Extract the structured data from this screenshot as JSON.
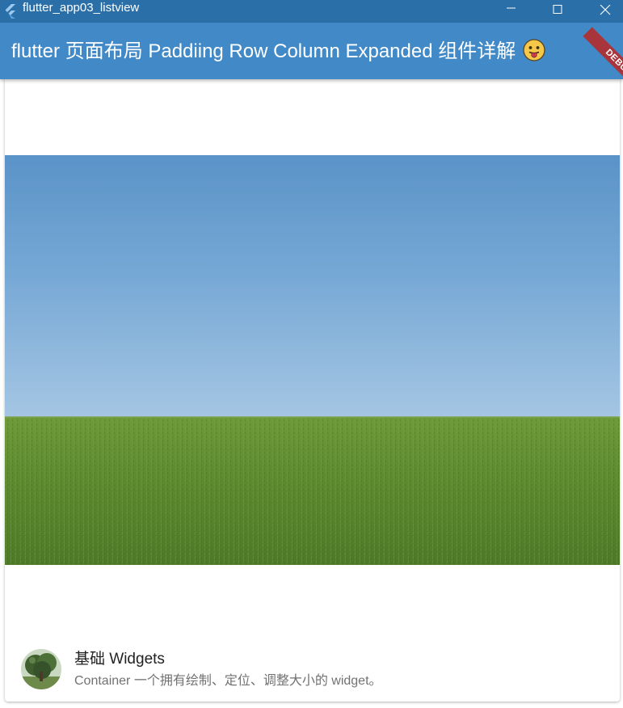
{
  "window": {
    "title": "flutter_app03_listview",
    "app_icon": "flutter-icon",
    "controls": [
      "minimize-icon",
      "maximize-icon",
      "close-icon"
    ]
  },
  "appbar": {
    "title": "flutter 页面布局 Paddiing Row Column Expanded 组件详解",
    "title_emoji": "face-with-tongue-emoji",
    "background": "#4189c7",
    "debug_banner": "DEBUG"
  },
  "card": {
    "image": "grass-field-blue-sky-photo",
    "tile": {
      "avatar": "tree-photo-avatar",
      "title": "基础 Widgets",
      "subtitle": "Container 一个拥有绘制、定位、调整大小的 widget。"
    }
  },
  "colors": {
    "titlebar": "#2b6fa8",
    "appbar": "#4189c7",
    "ribbon": "#a8353c"
  }
}
